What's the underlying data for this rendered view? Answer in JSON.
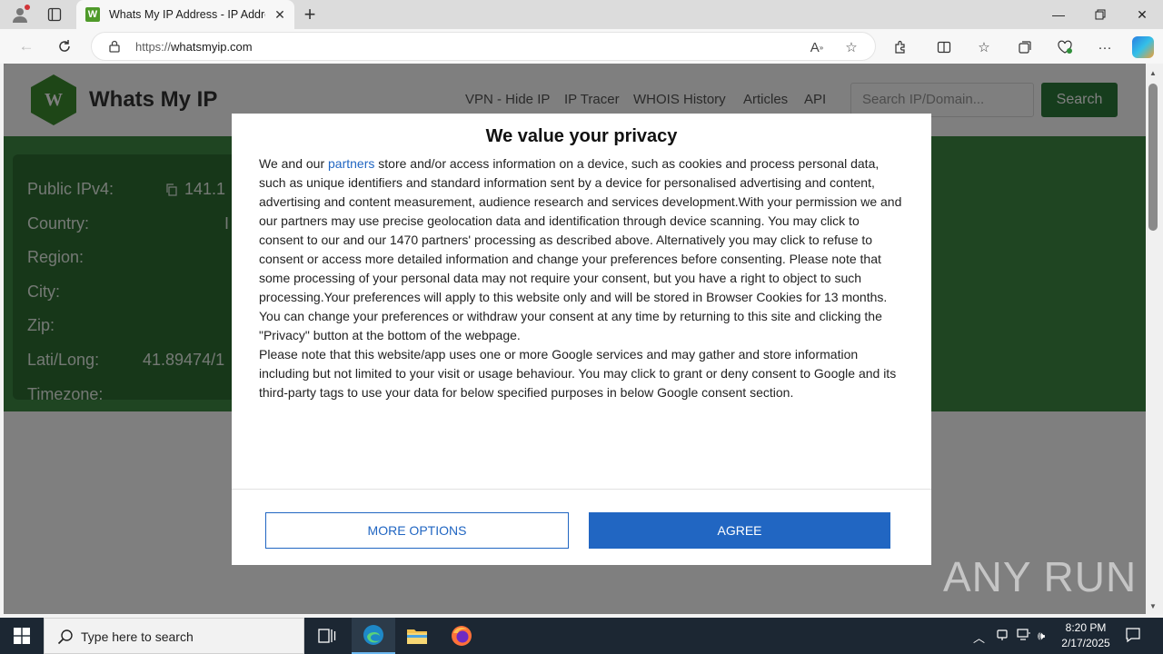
{
  "browser": {
    "tab_title": "Whats My IP Address - IP Address",
    "favicon_letter": "W",
    "url_proto": "https://",
    "url_host": "whatsmyip.com"
  },
  "site": {
    "logo_letter": "W",
    "name": "Whats My IP",
    "nav": [
      "VPN - Hide IP",
      "IP Tracer",
      "WHOIS History",
      "Articles",
      "API"
    ],
    "search_placeholder": "Search IP/Domain...",
    "search_button": "Search",
    "info_labels": [
      "Public IPv4:",
      "Country:",
      "Region:",
      "City:",
      "Zip:",
      "Lati/Long:",
      "Timezone:"
    ],
    "ipv4_partial": "141.1",
    "country_partial": "I",
    "latlong_partial": "41.89474/1"
  },
  "modal": {
    "title": "We value your privacy",
    "body_prefix": "We and our ",
    "partners_link": "partners",
    "body_p1": " store and/or access information on a device, such as cookies and process personal data, such as unique identifiers and standard information sent by a device for personalised advertising and content, advertising and content measurement, audience research and services development.With your permission we and our partners may use precise geolocation data and identification through device scanning. You may click to consent to our and our 1470 partners' processing as described above. Alternatively you may click to refuse to consent or access more detailed information and change your preferences before consenting. Please note that some processing of your personal data may not require your consent, but you have a right to object to such processing.Your preferences will apply to this website only and will be stored in Browser Cookies for 13 months. You can change your preferences or withdraw your consent at any time by returning to this site and clicking the \"Privacy\" button at the bottom of the webpage.",
    "body_p2": "Please note that this website/app uses one or more Google services and may gather and store information including but not limited to your visit or usage behaviour. You may click to grant or deny consent to Google and its third-party tags to use your data for below specified purposes in below Google consent section.",
    "more_options": "MORE OPTIONS",
    "agree": "AGREE"
  },
  "watermark": "ANY RUN",
  "taskbar": {
    "search_text": "Type here to search",
    "time": "8:20 PM",
    "date": "2/17/2025"
  },
  "colors": {
    "accent_blue": "#2166c2",
    "site_green": "#3e8a44"
  }
}
